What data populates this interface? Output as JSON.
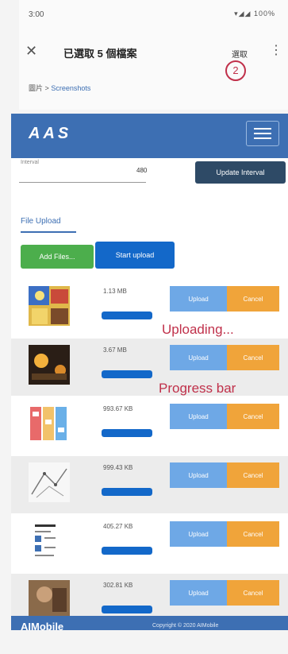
{
  "status_bar": {
    "time": "3:00",
    "signal": "▾◢◢ 100%"
  },
  "picker": {
    "title": "已選取 5 個檔案",
    "done_label": "選取",
    "step_badge": "2",
    "breadcrumb_root": "圖片",
    "breadcrumb_sep": ">",
    "breadcrumb_current": "Screenshots"
  },
  "app": {
    "brand": "AAS",
    "interval": {
      "label": "Interval",
      "value": "480",
      "button_label": "Update Interval"
    },
    "file_upload": {
      "title": "File Upload",
      "add_files_label": "Add Files...",
      "start_upload_label": "Start upload"
    },
    "files": [
      {
        "size": "1.13 MB",
        "upload_label": "Upload",
        "cancel_label": "Cancel",
        "progress": 1.0,
        "thumb": "colorful-collage"
      },
      {
        "size": "3.67 MB",
        "upload_label": "Upload",
        "cancel_label": "Cancel",
        "progress": 1.0,
        "thumb": "dark-night-scene"
      },
      {
        "size": "993.67 KB",
        "upload_label": "Upload",
        "cancel_label": "Cancel",
        "progress": 1.0,
        "thumb": "colorful-posters"
      },
      {
        "size": "999.43 KB",
        "upload_label": "Upload",
        "cancel_label": "Cancel",
        "progress": 1.0,
        "thumb": "line-sketch"
      },
      {
        "size": "405.27 KB",
        "upload_label": "Upload",
        "cancel_label": "Cancel",
        "progress": 1.0,
        "thumb": "document-page"
      },
      {
        "size": "302.81 KB",
        "upload_label": "Upload",
        "cancel_label": "Cancel",
        "progress": 1.0,
        "thumb": "brown-photo"
      }
    ],
    "annotations": {
      "uploading": "Uploading...",
      "progress_bar": "Progress bar"
    },
    "footer": {
      "brand": "AIMobile",
      "copyright": "Copyright © 2020 AIMobile"
    }
  },
  "colors": {
    "navbar": "#3d6fb3",
    "interval_button": "#2e4a66",
    "add_files": "#4cae4c",
    "start_upload": "#1368c9",
    "row_upload": "#6ea8e6",
    "row_cancel": "#f0a43a",
    "annotation": "#c0304a",
    "progress_fill": "#1368c9"
  }
}
